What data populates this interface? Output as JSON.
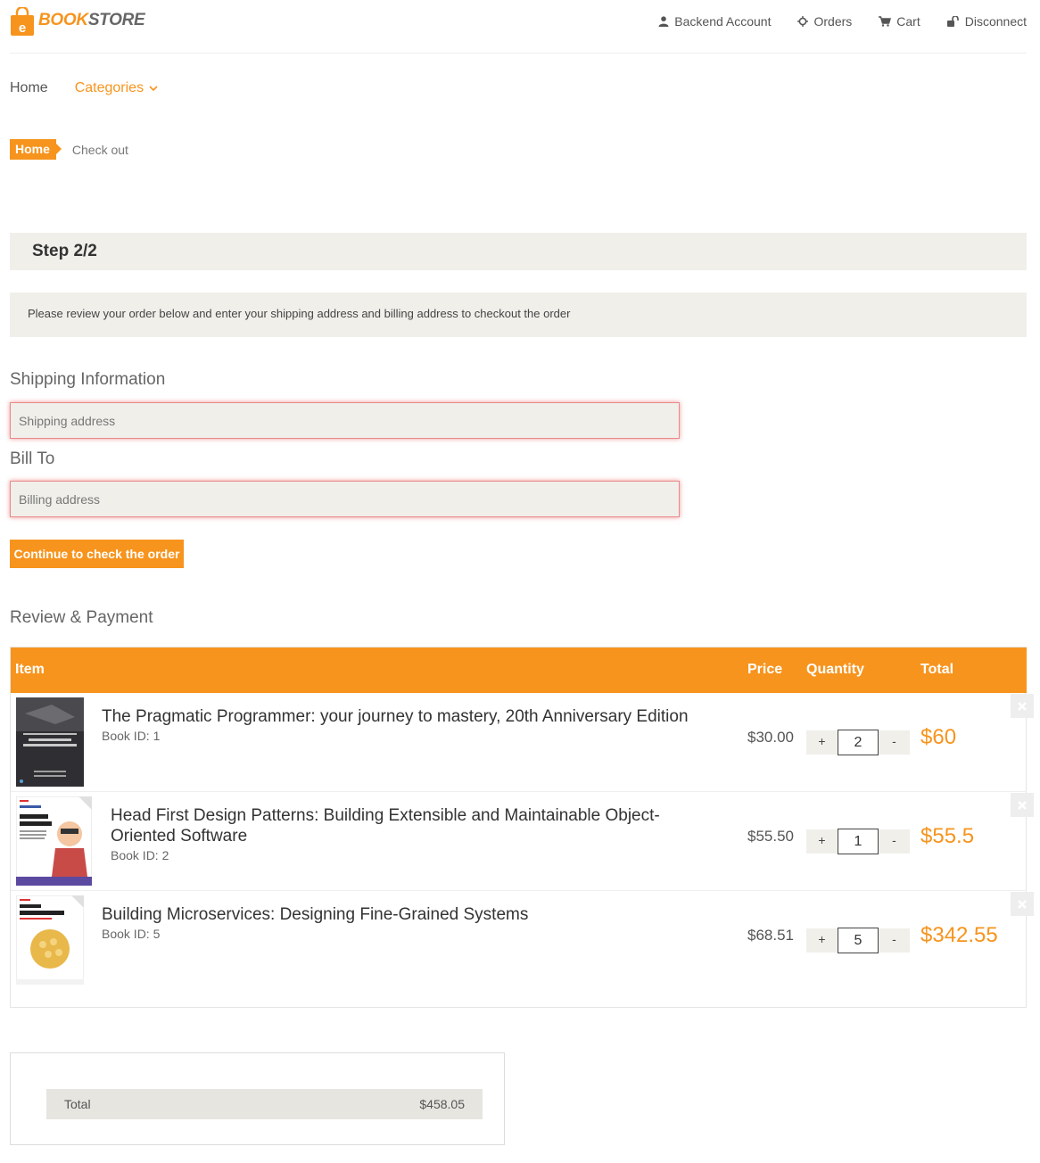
{
  "brand": {
    "part1": "BOOK",
    "part2": "STORE",
    "icon_letter": "e"
  },
  "top_links": [
    {
      "label": "Backend Account",
      "icon": "user-icon"
    },
    {
      "label": "Orders",
      "icon": "crosshair-icon"
    },
    {
      "label": "Cart",
      "icon": "cart-icon"
    },
    {
      "label": "Disconnect",
      "icon": "unlock-icon"
    }
  ],
  "nav": {
    "home": "Home",
    "categories": "Categories"
  },
  "breadcrumb": {
    "home": "Home",
    "current": "Check out"
  },
  "step": "Step 2/2",
  "notice": "Please review your order below and enter your shipping address and billing address to checkout the order",
  "shipping": {
    "title": "Shipping Information",
    "placeholder": "Shipping address"
  },
  "billing": {
    "title": "Bill To",
    "placeholder": "Billing address"
  },
  "continue_label": "Continue to check the order",
  "review_title": "Review & Payment",
  "table": {
    "headers": {
      "item": "Item",
      "price": "Price",
      "quantity": "Quantity",
      "total": "Total"
    },
    "rows": [
      {
        "title": "The Pragmatic Programmer: your journey to mastery, 20th Anniversary Edition",
        "book_id": "Book ID: 1",
        "price": "$30.00",
        "qty": "2",
        "total": "$60",
        "plus": "+",
        "minus": "-"
      },
      {
        "title": "Head First Design Patterns: Building Extensible and Maintainable Object-Oriented Software",
        "book_id": "Book ID: 2",
        "price": "$55.50",
        "qty": "1",
        "total": "$55.5",
        "plus": "+",
        "minus": "-"
      },
      {
        "title": "Building Microservices: Designing Fine-Grained Systems",
        "book_id": "Book ID: 5",
        "price": "$68.51",
        "qty": "5",
        "total": "$342.55",
        "plus": "+",
        "minus": "-"
      }
    ]
  },
  "summary": {
    "label": "Total",
    "value": "$458.05"
  },
  "colors": {
    "accent": "#f7941d",
    "panel": "#f0efea"
  }
}
